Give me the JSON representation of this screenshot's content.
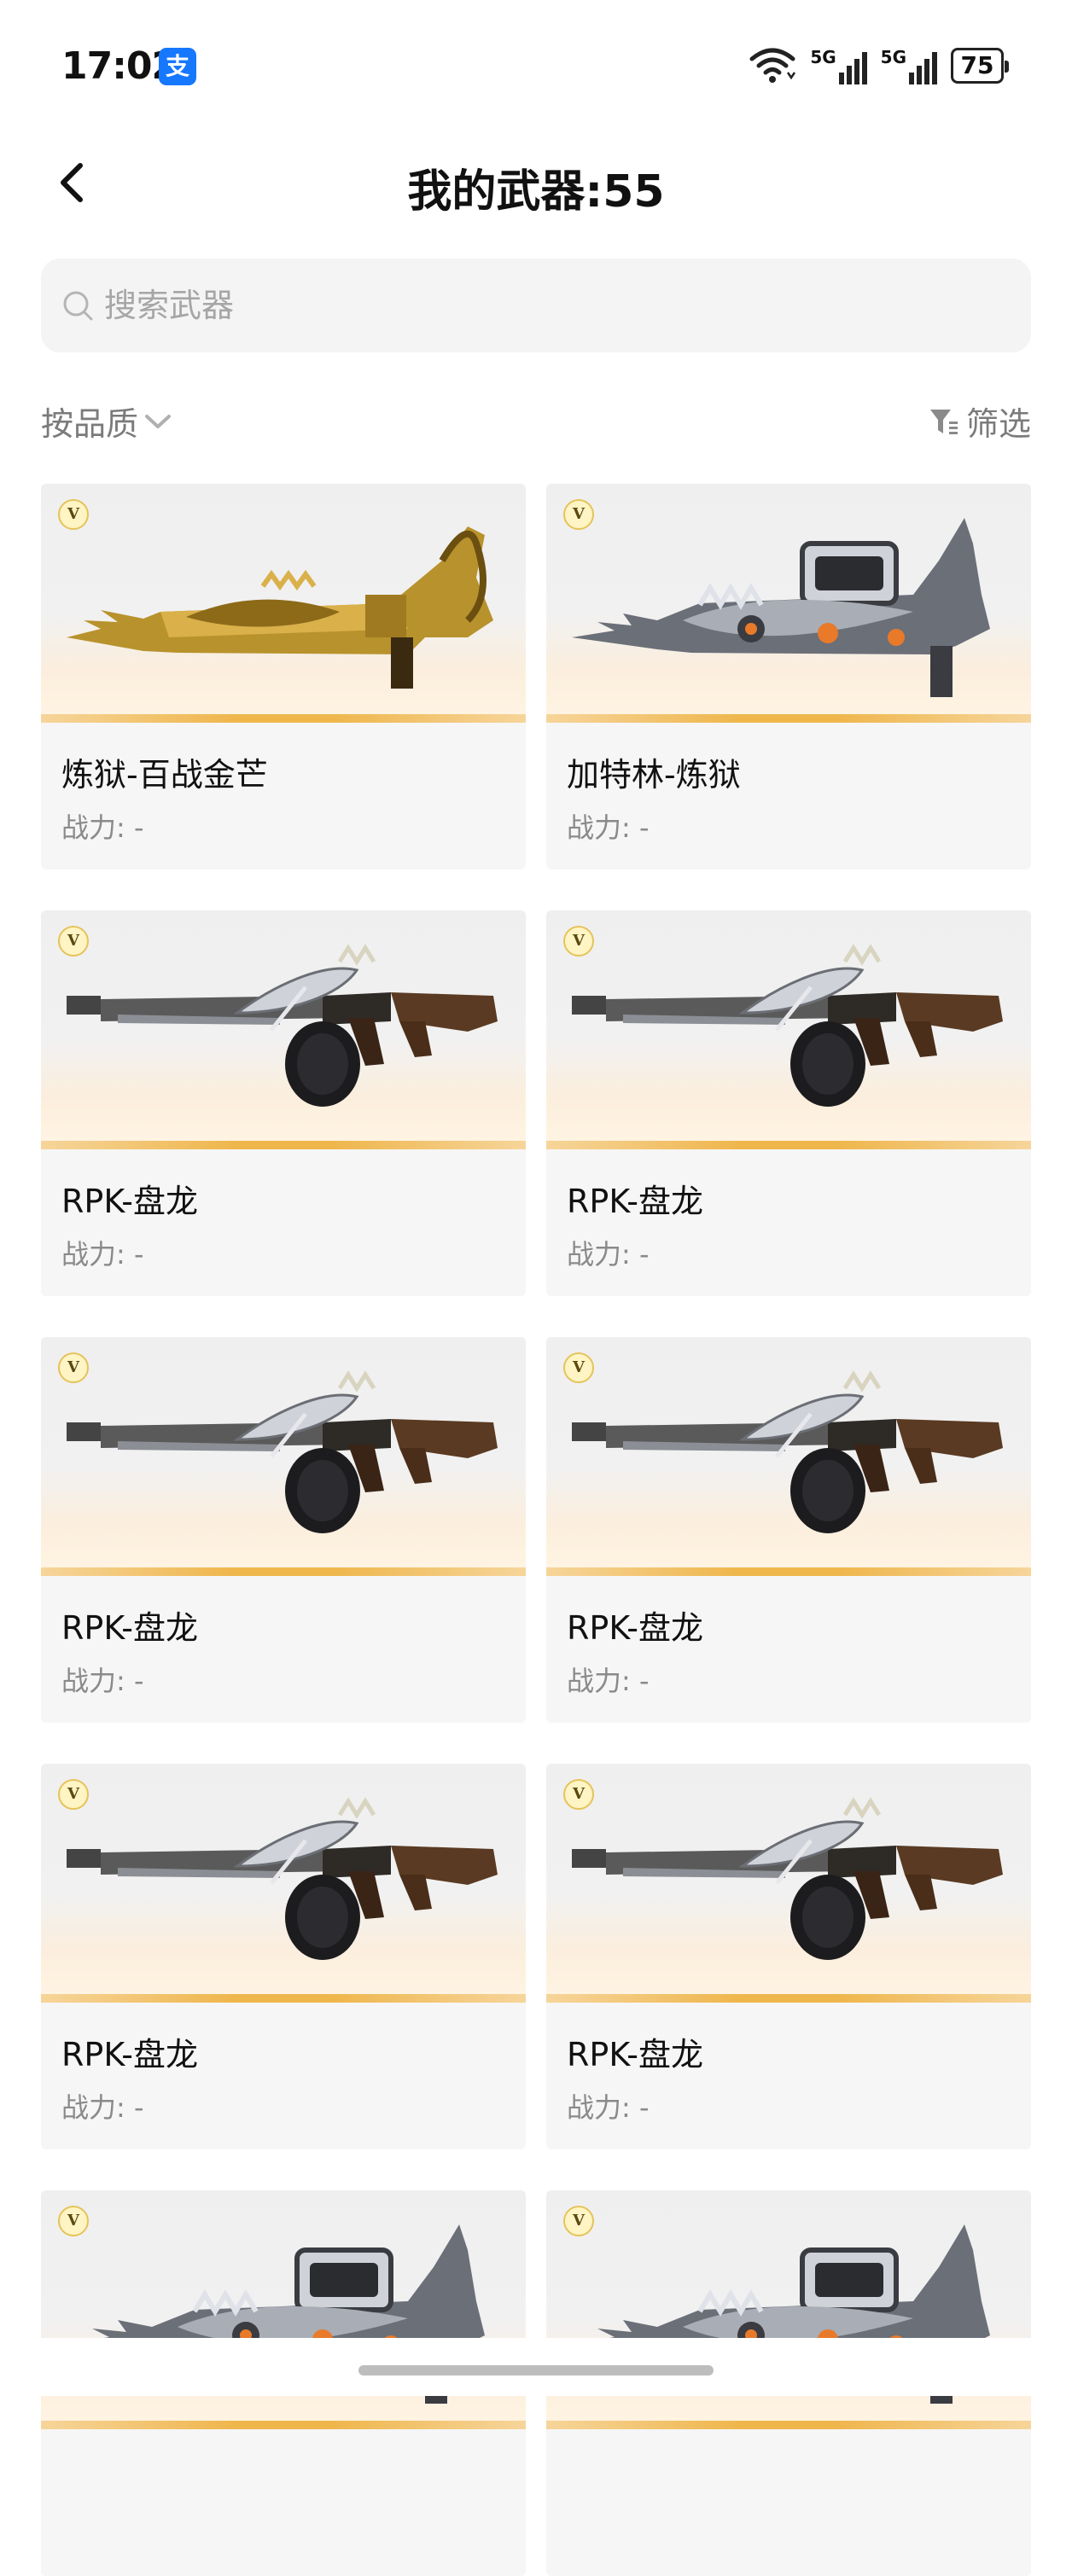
{
  "status_bar": {
    "time": "17:02",
    "app_badge": "支",
    "network": "5G",
    "network2": "5G",
    "battery": "75"
  },
  "header": {
    "title": "我的武器:55"
  },
  "search": {
    "placeholder": "搜索武器",
    "value": ""
  },
  "toolbar": {
    "sort_label": "按品质",
    "filter_label": "筛选"
  },
  "colors": {
    "accent_bar": "#efb64c",
    "card_bg": "#f6f6f6",
    "muted_text": "#8a8a8a"
  },
  "badge_letter": "V",
  "weapons": [
    {
      "name": "炼狱-百战金芒",
      "power_label": "战力: -",
      "icon": "gatling-gold-icon"
    },
    {
      "name": "加特林-炼狱",
      "power_label": "战力: -",
      "icon": "gatling-silver-icon"
    },
    {
      "name": "RPK-盘龙",
      "power_label": "战力: -",
      "icon": "rpk-rifle-icon"
    },
    {
      "name": "RPK-盘龙",
      "power_label": "战力: -",
      "icon": "rpk-rifle-icon"
    },
    {
      "name": "RPK-盘龙",
      "power_label": "战力: -",
      "icon": "rpk-rifle-icon"
    },
    {
      "name": "RPK-盘龙",
      "power_label": "战力: -",
      "icon": "rpk-rifle-icon"
    },
    {
      "name": "RPK-盘龙",
      "power_label": "战力: -",
      "icon": "rpk-rifle-icon"
    },
    {
      "name": "RPK-盘龙",
      "power_label": "战力: -",
      "icon": "rpk-rifle-icon"
    },
    {
      "name": "",
      "power_label": "",
      "icon": "gatling-silver-icon"
    },
    {
      "name": "",
      "power_label": "",
      "icon": "gatling-silver-icon"
    }
  ]
}
